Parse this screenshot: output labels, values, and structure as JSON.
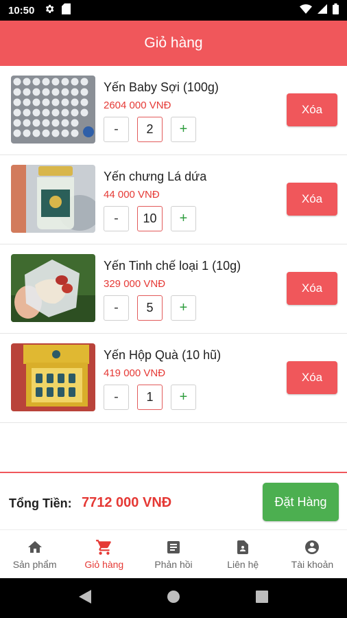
{
  "status_bar": {
    "time": "10:50"
  },
  "header": {
    "title": "Giỏ hàng"
  },
  "cart": {
    "minus_label": "-",
    "plus_label": "+",
    "delete_label": "Xóa",
    "items": [
      {
        "name": "Yến Baby Sợi (100g)",
        "price": "2604 000 VNĐ",
        "quantity": "2",
        "image": "bird-nest-tray-photo"
      },
      {
        "name": "Yến chưng Lá dứa",
        "price": "44 000 VNĐ",
        "quantity": "10",
        "image": "bird-nest-jar-photo"
      },
      {
        "name": "Yến Tinh chế loại 1 (10g)",
        "price": "329 000 VNĐ",
        "quantity": "5",
        "image": "refined-nest-bag-photo"
      },
      {
        "name": "Yến Hộp Quà (10 hũ)",
        "price": "419 000 VNĐ",
        "quantity": "1",
        "image": "gift-box-photo"
      }
    ]
  },
  "summary": {
    "total_label": "Tổng Tiền:",
    "total_value": "7712 000 VNĐ",
    "order_button": "Đặt Hàng"
  },
  "bottom_nav": {
    "items": [
      {
        "label": "Sản phẩm",
        "icon": "home-icon"
      },
      {
        "label": "Giỏ hàng",
        "icon": "cart-icon",
        "active": true
      },
      {
        "label": "Phản hồi",
        "icon": "document-icon"
      },
      {
        "label": "Liên hệ",
        "icon": "contact-card-icon"
      },
      {
        "label": "Tài khoản",
        "icon": "account-icon"
      }
    ]
  },
  "colors": {
    "primary": "#f0575b",
    "price": "#e53935",
    "order": "#4caf50",
    "plus": "#2e9d3e"
  }
}
